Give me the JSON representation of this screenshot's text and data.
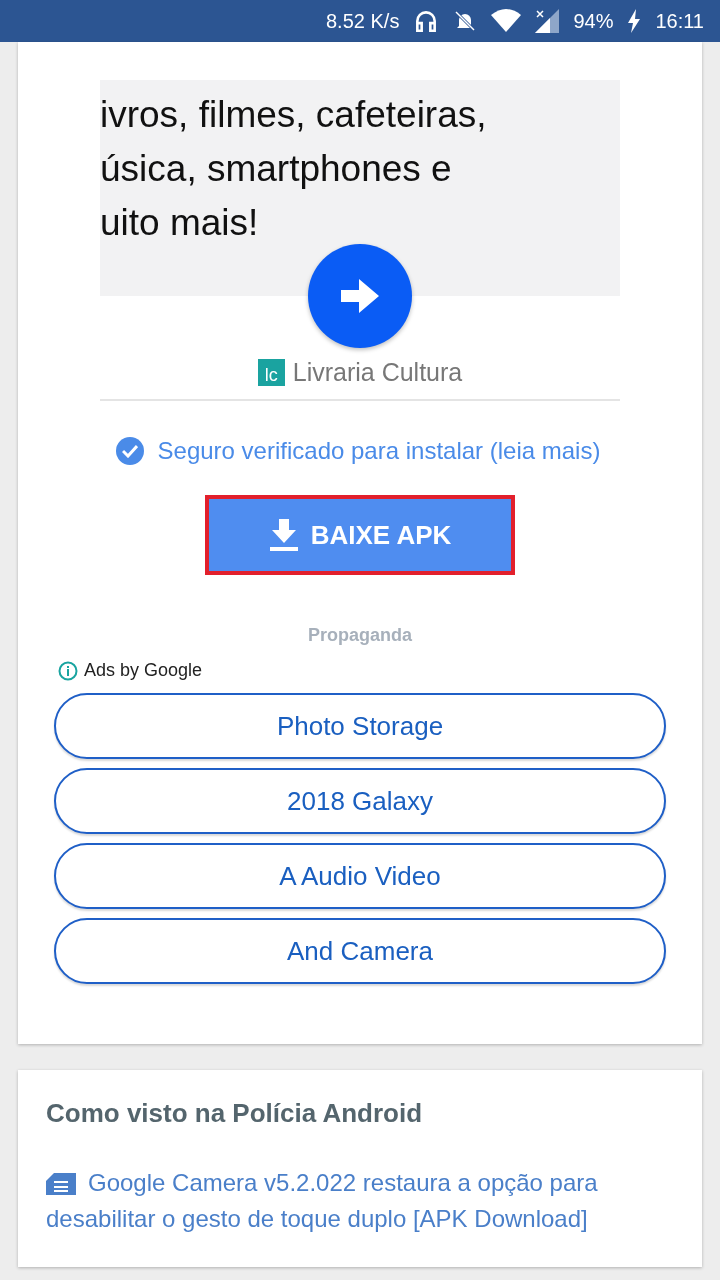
{
  "status_bar": {
    "speed": "8.52 K/s",
    "battery": "94%",
    "time": "16:11"
  },
  "ad_banner": {
    "lines": [
      "ivros, filmes, cafeteiras,",
      "úsica, smartphones e",
      "uito mais!"
    ],
    "advertiser": "Livraria Cultura",
    "logo": "lc"
  },
  "verified": {
    "text": "Seguro verificado para instalar (leia mais)",
    "checked": true
  },
  "download_button": {
    "label": "BAIXE APK"
  },
  "ads": {
    "caption": "Propaganda",
    "attribution": "Ads by Google",
    "links": [
      "Photo Storage",
      "2018 Galaxy",
      "A Audio Video",
      "And Camera"
    ]
  },
  "seen_on": {
    "title": "Como visto na Polícia Android",
    "article": "Google Camera v5.2.022 restaura a opção para desabilitar o gesto de toque duplo [APK Download]"
  }
}
